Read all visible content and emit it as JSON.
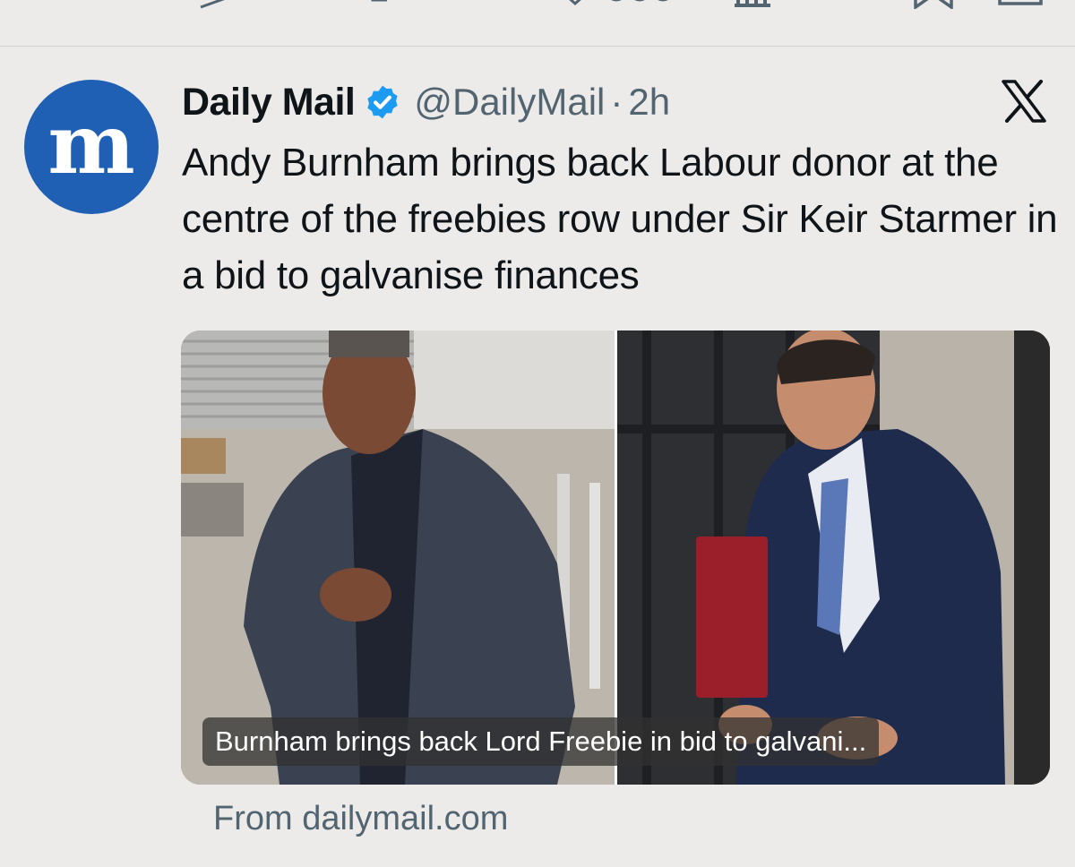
{
  "action_bar": {
    "icons": [
      "reply-icon",
      "retweet-icon",
      "like-icon",
      "views-icon",
      "bookmark-icon",
      "share-icon"
    ],
    "counts": [
      "",
      "",
      "",
      ""
    ]
  },
  "tweet": {
    "author_name": "Daily Mail",
    "verified": true,
    "handle": "@DailyMail",
    "separator": "·",
    "time": "2h",
    "text": "Andy Burnham brings back Labour donor at the centre of the freebies row under Sir Keir Starmer in a bid to galvanise finances",
    "avatar_letters": "m"
  },
  "card": {
    "caption": "Burnham brings back Lord Freebie in bid to galvani...",
    "source": "From dailymail.com"
  },
  "colors": {
    "background": "#ecebea",
    "brand_blue": "#1f5fb4",
    "verified_blue": "#1d9bf0",
    "muted_text": "#536471"
  }
}
